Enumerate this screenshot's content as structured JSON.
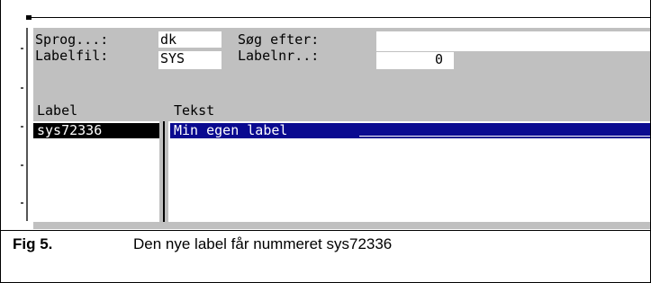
{
  "form": {
    "sprog_label": "Sprog...:",
    "sprog_value": "dk",
    "labelfil_label": "Labelfil:",
    "labelfil_value": "SYS",
    "sog_label": "Søg efter:",
    "sog_value": "",
    "labelnr_label": "Labelnr..:",
    "labelnr_value": "0"
  },
  "table": {
    "columns": [
      "Label",
      "Tekst"
    ],
    "rows": [
      {
        "label": "sys72336",
        "text": "Min egen label"
      }
    ]
  },
  "caption": {
    "number": "Fig 5.",
    "text": "Den nye label får nummeret sys72336"
  },
  "colors": {
    "terminal_grey": "#c0c0c0",
    "selection_blue": "#0a0a90",
    "selection_black": "#000000"
  }
}
